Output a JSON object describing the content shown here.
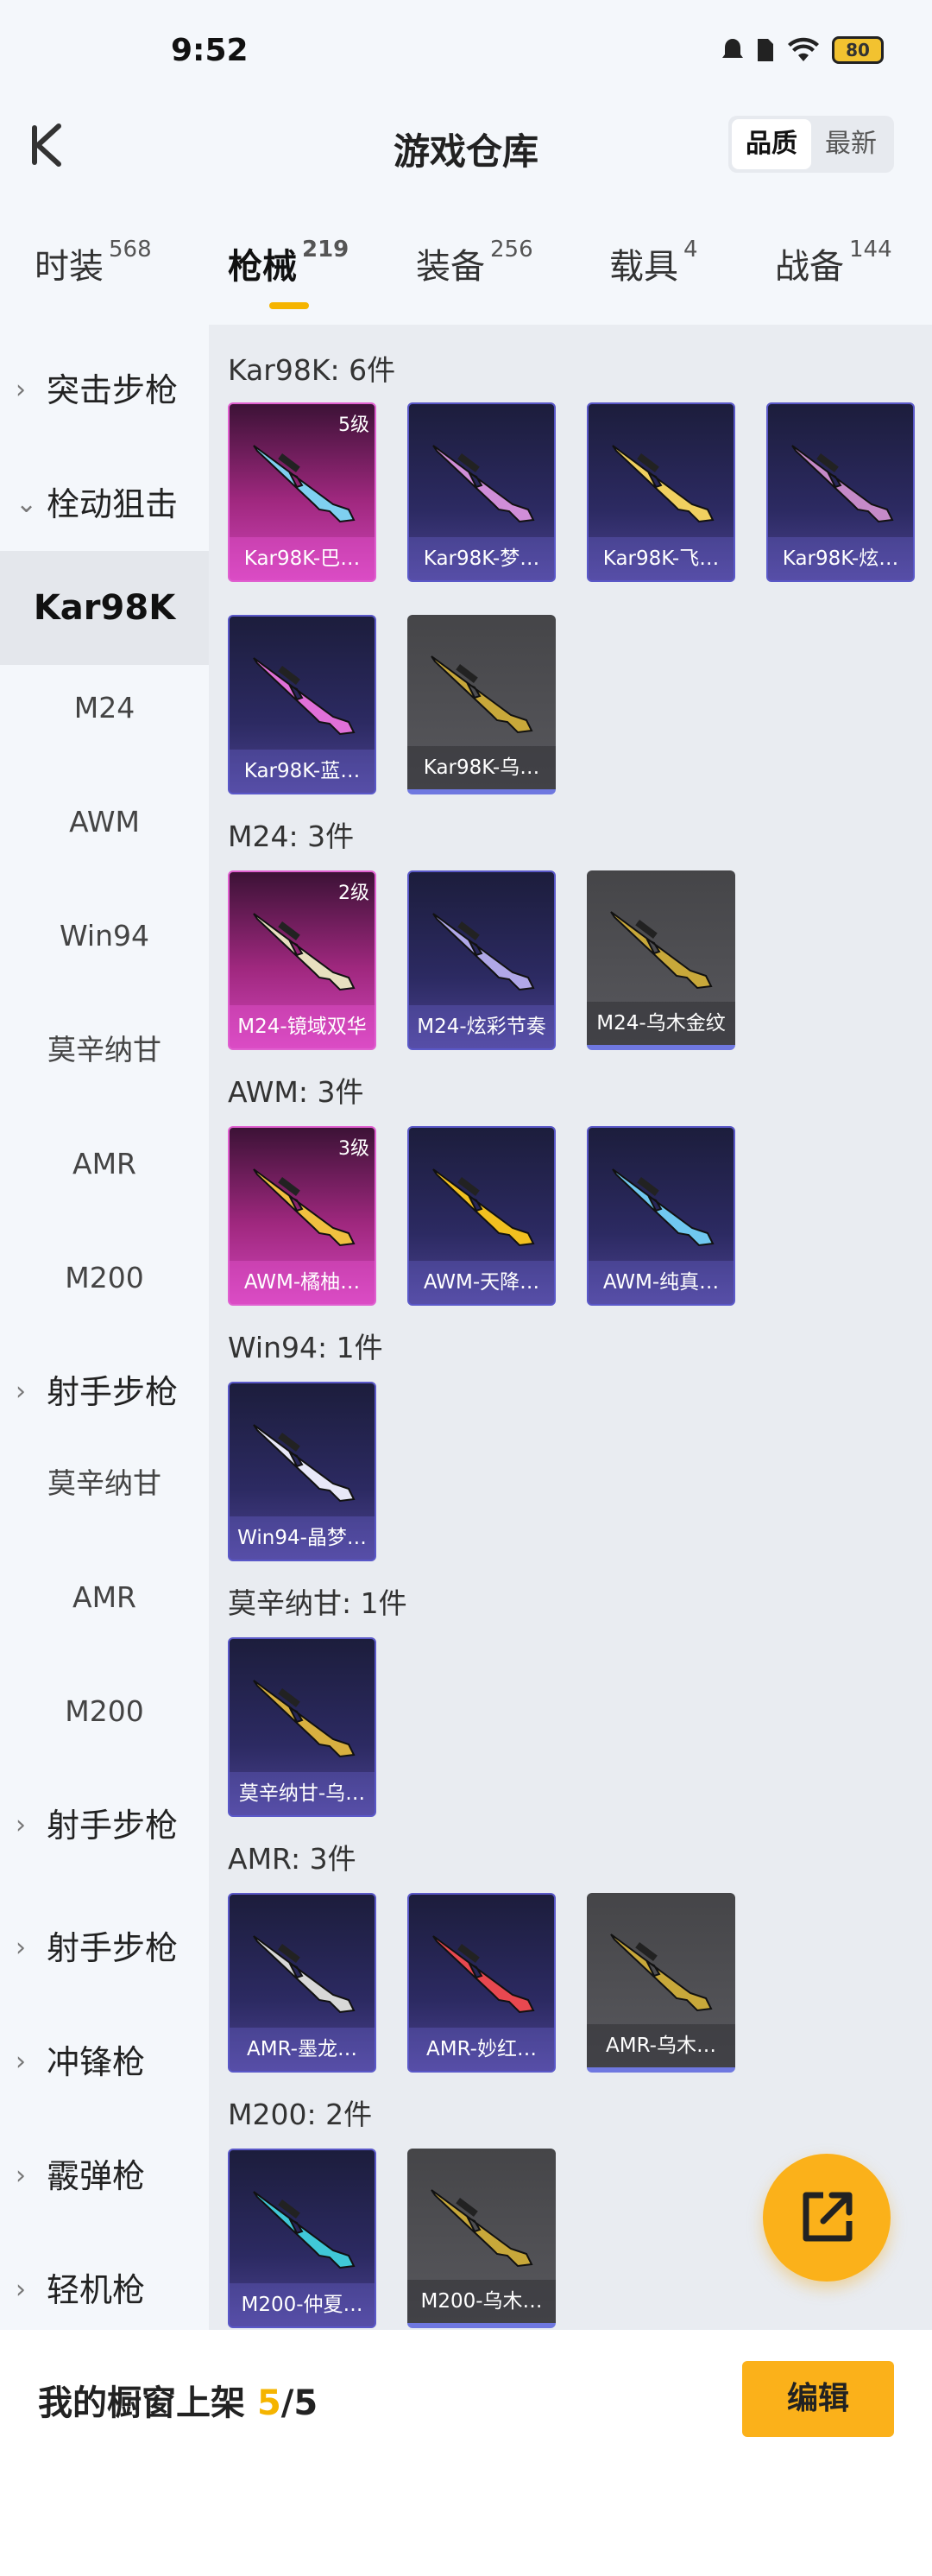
{
  "status_bar": {
    "time": "9:52",
    "battery": "80"
  },
  "header": {
    "title": "游戏仓库",
    "sort_quality": "品质",
    "sort_newest": "最新"
  },
  "tabs": [
    {
      "label": "时装",
      "count": "568"
    },
    {
      "label": "枪械",
      "count": "219"
    },
    {
      "label": "装备",
      "count": "256"
    },
    {
      "label": "载具",
      "count": "4"
    },
    {
      "label": "战备",
      "count": "144"
    }
  ],
  "sidebar": {
    "items": [
      {
        "label": "突击步枪",
        "type": "category",
        "chevron": "›"
      },
      {
        "label": "栓动狙击",
        "type": "category",
        "chevron": "⌄"
      },
      {
        "label": "Kar98K",
        "type": "selected"
      },
      {
        "label": "M24",
        "type": "sub"
      },
      {
        "label": "AWM",
        "type": "sub"
      },
      {
        "label": "Win94",
        "type": "sub"
      },
      {
        "label": "莫辛纳甘",
        "type": "sub"
      },
      {
        "label": "AMR",
        "type": "sub"
      },
      {
        "label": "M200",
        "type": "sub"
      },
      {
        "label": "射手步枪",
        "type": "category",
        "chevron": "›"
      },
      {
        "label": "莫辛纳甘",
        "type": "sub"
      },
      {
        "label": "AMR",
        "type": "sub"
      },
      {
        "label": "M200",
        "type": "sub"
      },
      {
        "label": "射手步枪",
        "type": "category",
        "chevron": "›"
      },
      {
        "label": "射手步枪",
        "type": "category",
        "chevron": "›"
      },
      {
        "label": "冲锋枪",
        "type": "category",
        "chevron": "›"
      },
      {
        "label": "霰弹枪",
        "type": "category",
        "chevron": "›"
      },
      {
        "label": "轻机枪",
        "type": "category",
        "chevron": "›"
      }
    ]
  },
  "groups": [
    {
      "title": "Kar98K: 6件",
      "items": [
        {
          "name": "Kar98K-巴…",
          "rarity": "pink",
          "level": "5级",
          "gun_color": "#7fd0f0",
          "icon": "rifle-skin-icon"
        },
        {
          "name": "Kar98K-梦…",
          "rarity": "purple",
          "gun_color": "#d08ed8",
          "icon": "rifle-skin-icon"
        },
        {
          "name": "Kar98K-飞…",
          "rarity": "purple",
          "gun_color": "#f0d060",
          "icon": "rifle-skin-icon"
        },
        {
          "name": "Kar98K-炫…",
          "rarity": "purple",
          "gun_color": "#c58ac8",
          "icon": "rifle-skin-icon"
        },
        {
          "name": "Kar98K-蓝…",
          "rarity": "purple",
          "gun_color": "#e070d8",
          "icon": "rifle-skin-icon"
        },
        {
          "name": "Kar98K-乌…",
          "rarity": "grey",
          "gun_color": "#c8a83a",
          "icon": "rifle-skin-icon"
        }
      ]
    },
    {
      "title": "M24: 3件",
      "items": [
        {
          "name": "M24-镜域双华",
          "rarity": "pink",
          "level": "2级",
          "gun_color": "#e8e0c0",
          "icon": "rifle-skin-icon"
        },
        {
          "name": "M24-炫彩节奏",
          "rarity": "purple",
          "gun_color": "#b0a8e8",
          "icon": "rifle-skin-icon"
        },
        {
          "name": "M24-乌木金纹",
          "rarity": "grey",
          "gun_color": "#c8a83a",
          "icon": "rifle-skin-icon"
        }
      ]
    },
    {
      "title": "AWM: 3件",
      "items": [
        {
          "name": "AWM-橘柚…",
          "rarity": "pink",
          "level": "3级",
          "gun_color": "#f0c040",
          "icon": "rifle-skin-icon"
        },
        {
          "name": "AWM-天降…",
          "rarity": "purple",
          "gun_color": "#f2c020",
          "icon": "rifle-skin-icon"
        },
        {
          "name": "AWM-纯真…",
          "rarity": "purple",
          "gun_color": "#70c8f0",
          "icon": "rifle-skin-icon"
        }
      ]
    },
    {
      "title": "Win94: 1件",
      "items": [
        {
          "name": "Win94-晶梦…",
          "rarity": "purple",
          "gun_color": "#e8e8f8",
          "icon": "rifle-skin-icon"
        }
      ]
    },
    {
      "title": "莫辛纳甘: 1件",
      "items": [
        {
          "name": "莫辛纳甘-乌…",
          "rarity": "purple",
          "gun_color": "#d8b040",
          "icon": "rifle-skin-icon"
        }
      ]
    },
    {
      "title": "AMR: 3件",
      "items": [
        {
          "name": "AMR-墨龙…",
          "rarity": "purple",
          "gun_color": "#d8d8d8",
          "icon": "rifle-skin-icon"
        },
        {
          "name": "AMR-妙红…",
          "rarity": "purple",
          "gun_color": "#e84850",
          "icon": "rifle-skin-icon"
        },
        {
          "name": "AMR-乌木…",
          "rarity": "grey",
          "gun_color": "#c8a83a",
          "icon": "rifle-skin-icon"
        }
      ]
    },
    {
      "title": "M200: 2件",
      "items": [
        {
          "name": "M200-仲夏…",
          "rarity": "purple",
          "gun_color": "#40c8d8",
          "icon": "rifle-skin-icon"
        },
        {
          "name": "M200-乌木…",
          "rarity": "grey",
          "gun_color": "#c8a83a",
          "icon": "rifle-skin-icon"
        }
      ]
    }
  ],
  "fab": {
    "icon": "share-external-icon"
  },
  "footer": {
    "label": "我的橱窗上架 ",
    "count": "5",
    "separator": "/",
    "total": "5",
    "edit_label": "编辑"
  },
  "colors": {
    "accent": "#fbb11a",
    "highlight": "#f5b400",
    "pink_card": "#cf45b8",
    "purple_card": "#4b4290"
  }
}
